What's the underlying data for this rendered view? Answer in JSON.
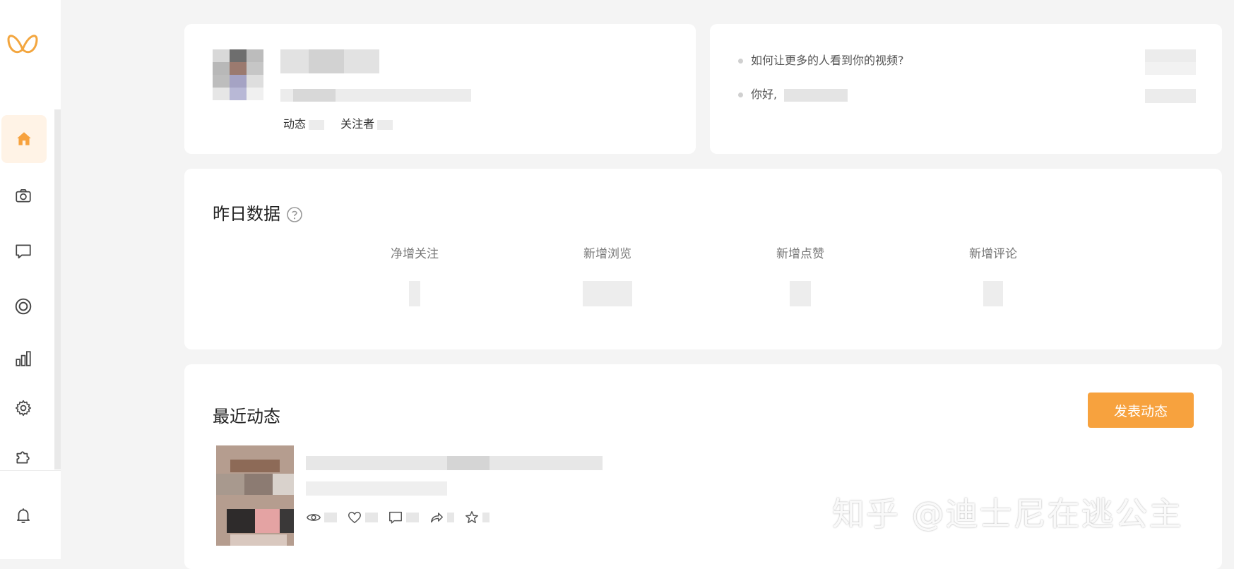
{
  "app": {
    "brand_color": "#f7a23e",
    "logo_icon": "butterfly-logo-icon"
  },
  "sidebar": {
    "items": [
      {
        "icon": "home-icon",
        "active": true
      },
      {
        "icon": "camera-icon",
        "active": false
      },
      {
        "icon": "message-icon",
        "active": false
      },
      {
        "icon": "target-icon",
        "active": false
      },
      {
        "icon": "bar-chart-icon",
        "active": false
      },
      {
        "icon": "gear-icon",
        "active": false
      },
      {
        "icon": "puzzle-icon",
        "active": false
      }
    ],
    "bell_icon": "bell-icon"
  },
  "profile": {
    "dynamics_label": "动态",
    "followers_label": "关注者"
  },
  "notices": {
    "items": [
      {
        "text": "如何让更多的人看到你的视频?"
      },
      {
        "text": "你好,"
      }
    ]
  },
  "stats": {
    "title": "昨日数据",
    "help_icon": "question-circle-icon",
    "columns": [
      {
        "label": "净增关注"
      },
      {
        "label": "新增浏览"
      },
      {
        "label": "新增点赞"
      },
      {
        "label": "新增评论"
      }
    ]
  },
  "recent": {
    "title": "最近动态",
    "publish_label": "发表动态",
    "actions": [
      "eye-icon",
      "heart-icon",
      "comment-icon",
      "share-icon",
      "star-icon"
    ]
  },
  "watermark": "知乎 @迪士尼在逃公主"
}
